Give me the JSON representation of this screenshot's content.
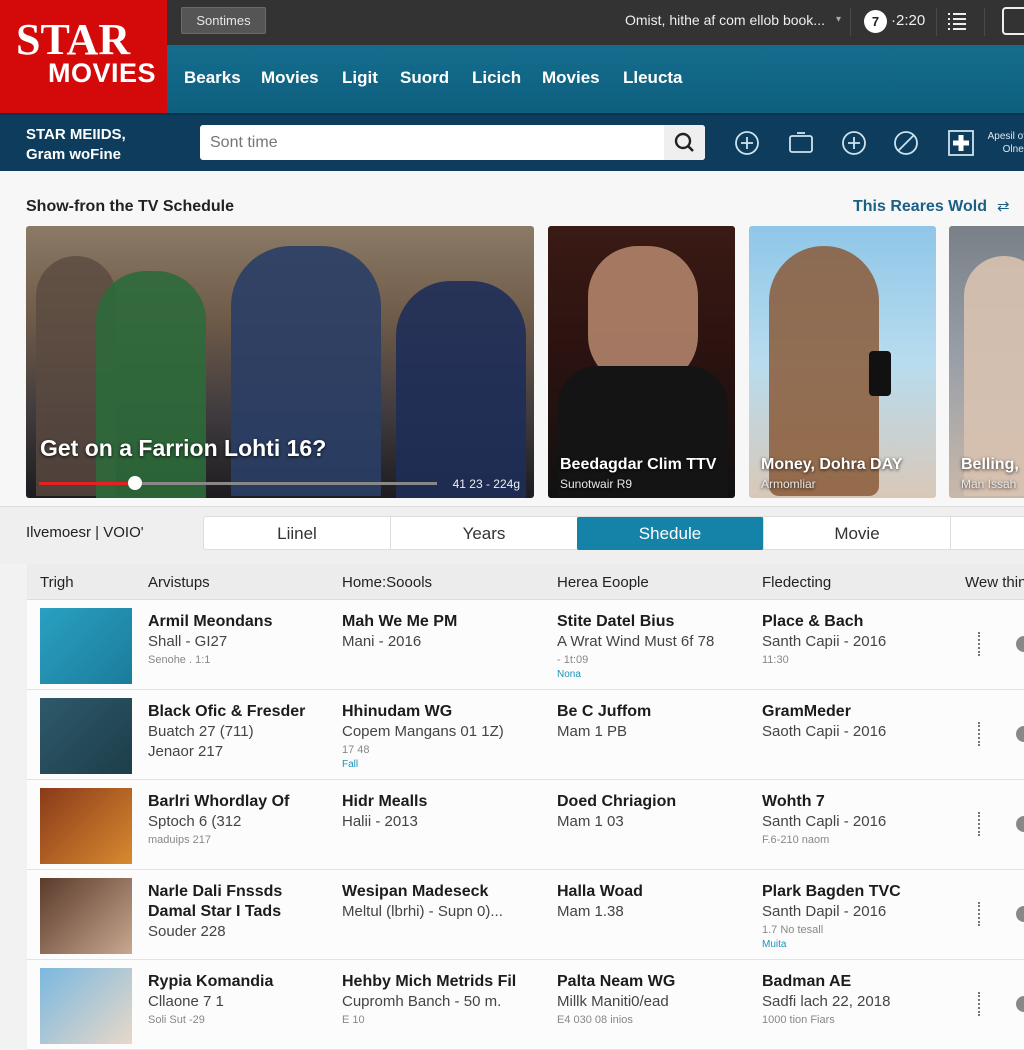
{
  "logo": {
    "line1": "STAR",
    "line2": "MOVIES"
  },
  "topbar": {
    "chip": "Sontimes",
    "account": "Omist,  hithe af com ellob book...",
    "badge": "7",
    "time": "·2:20"
  },
  "nav": {
    "items": [
      "Bearks",
      "Movies",
      "Ligit",
      "Suord",
      "Licich",
      "Movies",
      "Lleucta"
    ]
  },
  "subbar": {
    "brand_line1": "STAR MEIIDS,",
    "brand_line2": "Gram woFine",
    "search_placeholder": "Sont time",
    "info_line1": "Apesil ot",
    "info_line2": "Olnel"
  },
  "schedule": {
    "title": "Show-fron the TV Schedule",
    "link": "This Reares Wold",
    "hero": {
      "title": "Get on a Farrion Lohti 16?",
      "time": "41 23 - 224g",
      "progress": 0.24
    },
    "cards": [
      {
        "title": "Beedagdar Clim TTV",
        "sub": "Sunotwair R9"
      },
      {
        "title": "Money, Dohra DAY",
        "sub": "Armomliar"
      },
      {
        "title": "Belling,",
        "sub": "Man Issah"
      }
    ]
  },
  "filter": {
    "label": "Ilvemoesr | VOIO'",
    "tabs": [
      "Liinel",
      "Years",
      "Shedule",
      "Movie",
      ""
    ],
    "active_tab": 2
  },
  "table": {
    "headers": [
      "Trigh",
      "Arvistups",
      "Home:Soools",
      "Herea Eoople",
      "Fledecting",
      "Wew thin"
    ],
    "rows": [
      {
        "c1": {
          "b": [
            "Armil Meondans"
          ],
          "r": [
            "Shall - GI27"
          ],
          "s": "Senohe . 1:1",
          "t": ""
        },
        "c2": {
          "b": [
            "Mah We Me PM"
          ],
          "r": [
            "Mani - 2016"
          ],
          "s": "",
          "t": ""
        },
        "c3": {
          "b": [
            "Stite Datel Bius"
          ],
          "r": [
            "A Wrat Wind Must 6f 78"
          ],
          "s": "- 1t:09",
          "t": "Nona"
        },
        "c4": {
          "b": [
            "Place & Bach"
          ],
          "r": [
            "Santh Capii - 2016"
          ],
          "s": "11:30",
          "t": ""
        }
      },
      {
        "c1": {
          "b": [
            "Black Ofic & Fresder"
          ],
          "r": [
            "Buatch 27  (711)"
          ],
          "s": "",
          "t": "",
          "r2": "Jenaor  217"
        },
        "c2": {
          "b": [
            "Hhinudam WG"
          ],
          "r": [
            "Copem Mangans 01 1Z)"
          ],
          "s": "17 48",
          "t": "Fall"
        },
        "c3": {
          "b": [
            "Be C Juffom"
          ],
          "r": [
            "Mam 1 PB"
          ],
          "s": "",
          "t": ""
        },
        "c4": {
          "b": [
            "GramMeder"
          ],
          "r": [
            "Saoth Capii - 2016"
          ],
          "s": "",
          "t": ""
        }
      },
      {
        "c1": {
          "b": [
            "Barlri Whordlay Of"
          ],
          "r": [
            "Sptoch 6 (312"
          ],
          "s": "maduips 217",
          "t": ""
        },
        "c2": {
          "b": [
            "Hidr Mealls"
          ],
          "r": [
            "Halii - 2013"
          ],
          "s": "",
          "t": ""
        },
        "c3": {
          "b": [
            "Doed Chriagion"
          ],
          "r": [
            "Mam 1 03"
          ],
          "s": "",
          "t": ""
        },
        "c4": {
          "b": [
            "Wohth 7"
          ],
          "r": [
            "Santh Capli - 2016"
          ],
          "s": "F.6-210 naom",
          "t": ""
        }
      },
      {
        "c1": {
          "b": [
            "Narle Dali Fnssds",
            "Damal Star I Tads"
          ],
          "r": [
            "Souder 228"
          ],
          "s": "",
          "t": ""
        },
        "c2": {
          "b": [
            "Wesipan Madeseck"
          ],
          "r": [
            "Meltul (lbrhi) - Supn 0)..."
          ],
          "s": "",
          "t": ""
        },
        "c3": {
          "b": [
            "Halla Woad"
          ],
          "r": [
            "Mam 1.38"
          ],
          "s": "",
          "t": ""
        },
        "c4": {
          "b": [
            "Plark Bagden TVC"
          ],
          "r": [
            "Santh Dapil - 2016"
          ],
          "s": "1.7 No tesall",
          "t": "Muita"
        }
      },
      {
        "c1": {
          "b": [
            "Rypia Komandia"
          ],
          "r": [
            "Cllaone 7 1"
          ],
          "s": "Soli Sut -29",
          "t": ""
        },
        "c2": {
          "b": [
            "Hehby Mich Metrids Fil"
          ],
          "r": [
            "Cupromh Banch - 50 m."
          ],
          "s": "E 10",
          "t": ""
        },
        "c3": {
          "b": [
            "Palta Neam WG"
          ],
          "r": [
            "Millk Maniti0/ead"
          ],
          "s": "E4 030 08 inios",
          "t": ""
        },
        "c4": {
          "b": [
            "Badman AE"
          ],
          "r": [
            "Sadfi lach 22, 2018"
          ],
          "s": "1000 tion Fiars",
          "t": ""
        }
      }
    ]
  },
  "colors": {
    "brand_red": "#d40a0a",
    "nav_blue": "#146d8d",
    "subbar_navy": "#0d3c5c",
    "active_tab": "#1583a8",
    "link": "#1a5f86",
    "accent_text": "#1993b8"
  }
}
